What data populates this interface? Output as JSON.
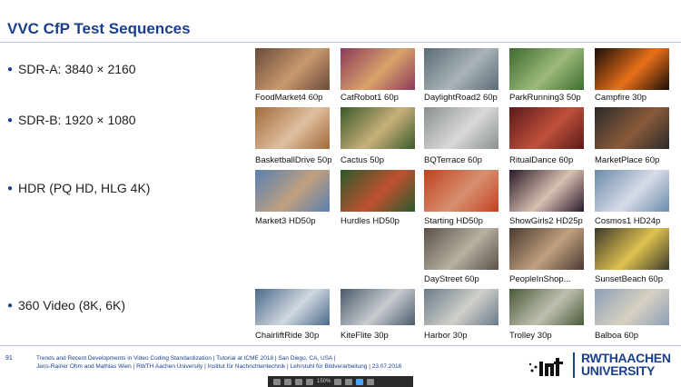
{
  "slide": {
    "title": "VVC CfP Test Sequences",
    "page_number": "91",
    "footer_line1": "Trends and Recent Developments in Video Coding Standardization  |  Tutorial at ICME 2018  |  San Diego, CA, USA  |",
    "footer_line2": "Jens-Rainer Ohm and Mathias Wien  |  RWTH Aachen University  |  Institut für Nachrichtentechnik  |  Lehrstuhl für Bildverarbeitung  |  23.07.2018",
    "logo_text_line1": "RWTHAACHEN",
    "logo_text_line2": "UNIVERSITY"
  },
  "bullets": [
    "SDR-A: 3840 × 2160",
    "SDR-B: 1920 × 1080",
    "HDR (PQ HD, HLG 4K)",
    "360 Video (8K, 6K)"
  ],
  "thumbnails": [
    {
      "caption": "FoodMarket4 60p",
      "colors": [
        "#6b4a3a",
        "#c99a6e"
      ]
    },
    {
      "caption": "CatRobot1 60p",
      "colors": [
        "#8c3a5a",
        "#d9a36b"
      ]
    },
    {
      "caption": "DaylightRoad2 60p",
      "colors": [
        "#5a6b76",
        "#aab4b8"
      ]
    },
    {
      "caption": "ParkRunning3 50p",
      "colors": [
        "#3f6b2f",
        "#9bb97a"
      ]
    },
    {
      "caption": "Campfire 30p",
      "colors": [
        "#1a0f08",
        "#e8701a"
      ]
    },
    {
      "caption": "BasketballDrive 50p",
      "colors": [
        "#a06a3a",
        "#e0c0a0"
      ]
    },
    {
      "caption": "Cactus 50p",
      "colors": [
        "#3a5a2a",
        "#c9b07a"
      ]
    },
    {
      "caption": "BQTerrace 60p",
      "colors": [
        "#8a8f90",
        "#d8dad8"
      ]
    },
    {
      "caption": "RitualDance 60p",
      "colors": [
        "#5a1a1a",
        "#c0503a"
      ]
    },
    {
      "caption": "MarketPlace 60p",
      "colors": [
        "#2a2a2a",
        "#8a5a3a"
      ]
    },
    {
      "caption": "Market3 HD50p",
      "colors": [
        "#5a7fb0",
        "#c0a080"
      ]
    },
    {
      "caption": "Hurdles HD50p",
      "colors": [
        "#2a5a2a",
        "#c05030"
      ]
    },
    {
      "caption": "Starting HD50p",
      "colors": [
        "#c04020",
        "#d89070"
      ]
    },
    {
      "caption": "ShowGirls2 HD25p",
      "colors": [
        "#2a1a2a",
        "#d8c0b0"
      ]
    },
    {
      "caption": "Cosmos1 HD24p",
      "colors": [
        "#6a8aa8",
        "#d8dce8"
      ]
    },
    {
      "caption": "DayStreet 60p",
      "colors": [
        "#5a5048",
        "#b8b0a0"
      ]
    },
    {
      "caption": "PeopleInShop...",
      "colors": [
        "#4a3a30",
        "#c0a080"
      ]
    },
    {
      "caption": "SunsetBeach 60p",
      "colors": [
        "#3a3a2a",
        "#e0c050"
      ]
    },
    {
      "caption": "ChairliftRide 30p",
      "colors": [
        "#4a6a8a",
        "#d0d8e0"
      ]
    },
    {
      "caption": "KiteFlite 30p",
      "colors": [
        "#4a5a6a",
        "#c8ccd0"
      ]
    },
    {
      "caption": "Harbor 30p",
      "colors": [
        "#6a7a8a",
        "#d0d0c8"
      ]
    },
    {
      "caption": "Trolley 30p",
      "colors": [
        "#4a5a3a",
        "#c0c0b0"
      ]
    },
    {
      "caption": "Balboa 60p",
      "colors": [
        "#8aa0b8",
        "#d8d0c0"
      ]
    }
  ],
  "colors": {
    "accent": "#1b3f8f"
  },
  "toolbar": {
    "zoom": "150%"
  }
}
